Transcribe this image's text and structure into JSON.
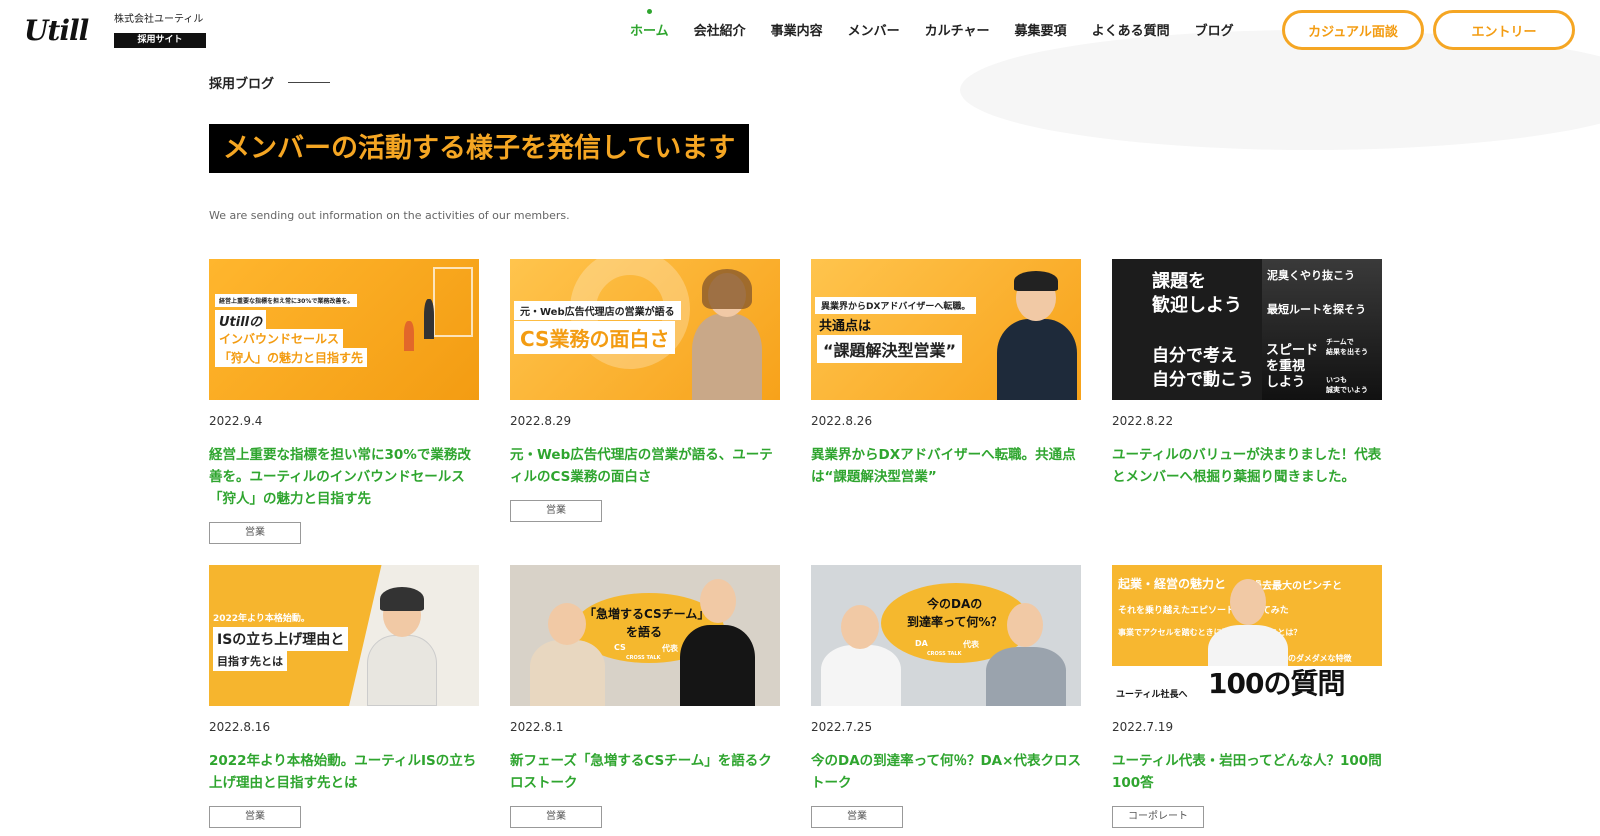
{
  "header": {
    "logo": "Utill",
    "company_name": "株式会社ユーティル",
    "badge": "採用サイト",
    "nav": [
      {
        "label": "ホーム",
        "active": true
      },
      {
        "label": "会社紹介",
        "active": false
      },
      {
        "label": "事業内容",
        "active": false
      },
      {
        "label": "メンバー",
        "active": false
      },
      {
        "label": "カルチャー",
        "active": false
      },
      {
        "label": "募集要項",
        "active": false
      },
      {
        "label": "よくある質問",
        "active": false
      },
      {
        "label": "ブログ",
        "active": false
      }
    ],
    "casual_button": "カジュアル面談",
    "entry_button": "エントリー"
  },
  "section": {
    "label": "採用ブログ",
    "headline": "メンバーの活動する様子を発信しています",
    "subtitle": "We are sending out information on the activities of our members."
  },
  "colors": {
    "accent_green": "#2fa52f",
    "accent_orange": "#f5a623",
    "headline_bg": "#000000"
  },
  "posts": [
    {
      "date": "2022.9.4",
      "title": "経営上重要な指標を担い常に30%で業務改善を。ユーティルのインバウンドセールス「狩人」の魅力と目指す先",
      "tag": "営業",
      "thumb": {
        "small": "経営上重要な指標を担え常に30%で業務改善を。",
        "line1": "Utillの",
        "line2": "インバウンドセールス",
        "line3": "「狩人」の魅力と目指す先"
      }
    },
    {
      "date": "2022.8.29",
      "title": "元・Web広告代理店の営業が語る、ユーティルのCS業務の面白さ",
      "tag": "営業",
      "thumb": {
        "line1": "元・Web広告代理店の営業が語る",
        "line2": "CS業務の面白さ"
      }
    },
    {
      "date": "2022.8.26",
      "title": "異業界からDXアドバイザーへ転職。共通点は“課題解決型営業”",
      "tag": "",
      "thumb": {
        "line1": "異業界からDXアドバイザーへ転職。",
        "line2": "共通点は",
        "line3": "“課題解決型営業”"
      }
    },
    {
      "date": "2022.8.22",
      "title": "ユーティルのバリューが決まりました！代表とメンバーへ根掘り葉掘り聞きました。",
      "tag": "",
      "thumb": {
        "v1": "課題を",
        "v2": "歓迎しよう",
        "v3": "泥臭くやり抜こう",
        "v4": "最短ルートを探そう",
        "v5": "自分で考え",
        "v6": "自分で動こう",
        "v7": "スピード",
        "v8": "を重視",
        "v9": "しよう",
        "v10": "チームで",
        "v11": "結果を出そう",
        "v12": "いつも",
        "v13": "誠実でいよう"
      }
    },
    {
      "date": "2022.8.16",
      "title": "2022年より本格始動。ユーティルISの立ち上げ理由と目指す先とは",
      "tag": "営業",
      "thumb": {
        "line1": "2022年より本格始動。",
        "line2": "ISの立ち上げ理由と",
        "line3": "目指す先とは"
      }
    },
    {
      "date": "2022.8.1",
      "title": "新フェーズ「急増するCSチーム」を語るクロストーク",
      "tag": "営業",
      "thumb": {
        "line1": "「急増するCSチーム」",
        "line2": "を語る",
        "left": "CS",
        "right": "代表",
        "small": "CROSS TALK"
      }
    },
    {
      "date": "2022.7.25",
      "title": "今のDAの到達率って何％？DA×代表クロストーク",
      "tag": "営業",
      "thumb": {
        "line1": "今のDAの",
        "line2": "到達率って何%？",
        "left": "DA",
        "right": "代表",
        "small": "CROSS TALK"
      }
    },
    {
      "date": "2022.7.19",
      "title": "ユーティル代表・岩田ってどんな人？100問100答",
      "tag": "コーポレート",
      "thumb": {
        "line1": "起業・経営の魅力と",
        "line2": "過去最大のピンチと",
        "line3": "それを乗り越えたエピソードを聞いてみた",
        "line4": "事業でアクセルを踏むときに意識していることは？",
        "line5": "自身のダメダメな特徴",
        "big": "100の質問",
        "label": "ユーティル社長へ"
      }
    }
  ]
}
